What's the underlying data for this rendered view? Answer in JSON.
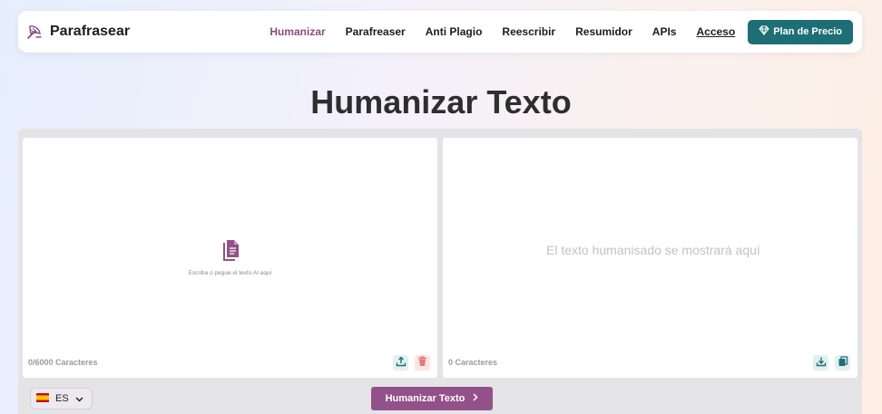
{
  "brand": {
    "name": "Parafrasear",
    "logo_icon": "feather-quill-icon"
  },
  "nav": {
    "links": [
      {
        "label": "Humanizar",
        "active": true
      },
      {
        "label": "Parafreaser"
      },
      {
        "label": "Anti Plagio"
      },
      {
        "label": "Reescribir"
      },
      {
        "label": "Resumidor"
      },
      {
        "label": "APIs"
      },
      {
        "label": "Acceso",
        "underline": true
      }
    ],
    "plan_button": {
      "label": "Plan de Precio",
      "icon": "diamond-icon"
    }
  },
  "page_title": "Humanizar Texto",
  "input_panel": {
    "prompt_icon": "document-icon",
    "prompt": "Escriba o pegue el texto AI aquí",
    "char_count": "0/6000 Caracteres",
    "actions": [
      {
        "name": "upload-icon",
        "color": "#1e6e76"
      },
      {
        "name": "trash-icon",
        "color": "#e07a7a"
      }
    ]
  },
  "output_panel": {
    "placeholder": "El texto humanisado se mostrará aquí",
    "char_count": "0 Caracteres",
    "actions": [
      {
        "name": "download-icon",
        "color": "#1e6e76"
      },
      {
        "name": "copy-icon",
        "color": "#1e6e76"
      }
    ]
  },
  "language": {
    "code": "ES",
    "flag": "spain-flag-icon"
  },
  "humanize_button": {
    "label": "Humanizar Texto",
    "icon": "chevron-right-icon"
  },
  "colors": {
    "accent": "#93518a",
    "brand_teal": "#1e6e76",
    "active_nav": "#8e4b7f"
  }
}
